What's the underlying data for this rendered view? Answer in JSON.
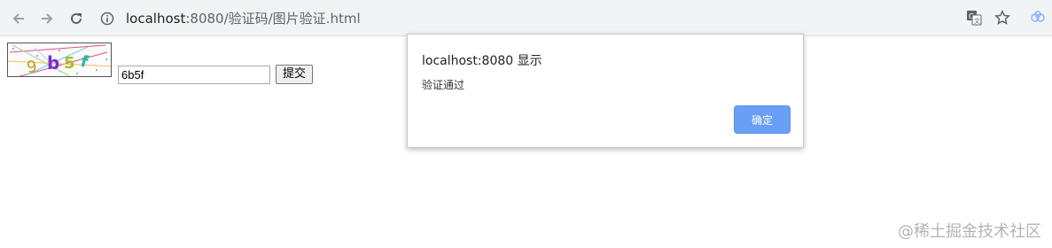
{
  "browser": {
    "url_host": "localhost",
    "url_rest": ":8080/验证码/图片验证.html",
    "icons": [
      "back-arrow-icon",
      "forward-arrow-icon",
      "reload-icon",
      "info-icon",
      "translate-icon",
      "star-icon",
      "extension-icon"
    ]
  },
  "page": {
    "captcha_text": "6b5f",
    "input_value": "6b5f",
    "submit_label": "提交"
  },
  "dialog": {
    "title": "localhost:8080 显示",
    "message": "验证通过",
    "ok_label": "确定",
    "ok_color": "#6a9ff7"
  },
  "watermark": "@稀土掘金技术社区"
}
